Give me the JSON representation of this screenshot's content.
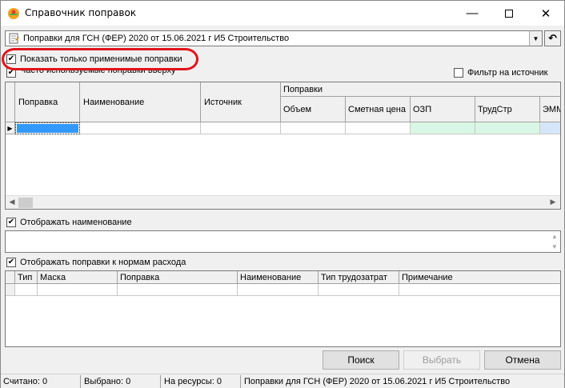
{
  "window": {
    "title": "Справочник поправок"
  },
  "selector": {
    "value": "Поправки для ГСН (ФЕР) 2020 от 15.06.2021 г И5 Строительство"
  },
  "checks": {
    "only_applicable": "Показать только применимые поправки",
    "frequent_top": "Часто используемые поправки вверху",
    "filter_source": "Фильтр на источник",
    "show_name": "Отображать наименование",
    "show_norms": "Отображать поправки к нормам расхода"
  },
  "grid1": {
    "columns": [
      "Поправка",
      "Наименование",
      "Источник"
    ],
    "group_label": "Поправки",
    "sub_columns": [
      "Объем",
      "Сметная цена",
      "ОЗП",
      "ТрудСтр",
      "ЭММ"
    ]
  },
  "grid2": {
    "columns": [
      "Тип",
      "Маска",
      "Поправка",
      "Наименование",
      "Тип трудозатрат",
      "Примечание"
    ]
  },
  "buttons": {
    "search": "Поиск",
    "choose": "Выбрать",
    "cancel": "Отмена"
  },
  "status": {
    "counted": "Считано: 0",
    "selected": "Выбрано: 0",
    "on_resources": "На ресурсы: 0",
    "current": "Поправки для ГСН (ФЕР) 2020 от 15.06.2021 г И5 Строительство"
  },
  "colors": {
    "highlight": "#e0141b",
    "ozp_cell": "#d9f7e4",
    "emm_cell": "#d6e6fa",
    "selected_cell": "#3399ff"
  }
}
